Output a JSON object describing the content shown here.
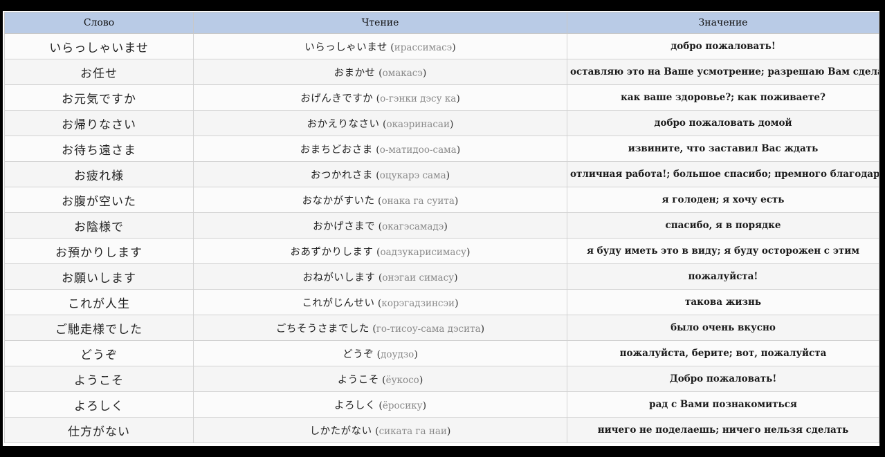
{
  "table": {
    "headers": [
      "Слово",
      "Чтение",
      "Значение"
    ],
    "rows": [
      {
        "word": "いらっしゃいませ",
        "kana": "いらっしゃいませ",
        "rom": "ирассимасэ",
        "meaning": "добро пожаловать!"
      },
      {
        "word": "お任せ",
        "kana": "おまかせ",
        "rom": "омакасэ",
        "meaning": "оставляю это на Ваше усмотрение; разрешаю Вам сделать это"
      },
      {
        "word": "お元気ですか",
        "kana": "おげんきですか",
        "rom": "о-гэнки дэсу ка",
        "meaning": "как ваше здоровье?; как поживаете?"
      },
      {
        "word": "お帰りなさい",
        "kana": "おかえりなさい",
        "rom": "окаэринасаи",
        "meaning": "добро пожаловать домой"
      },
      {
        "word": "お待ち遠さま",
        "kana": "おまちどおさま",
        "rom": "о-матидоо-сама",
        "meaning": "извините, что заставил Вас ждать"
      },
      {
        "word": "お疲れ様",
        "kana": "おつかれさま",
        "rom": "оцукарэ сама",
        "meaning": "отличная работа!; большое спасибо; премного благодарен"
      },
      {
        "word": "お腹が空いた",
        "kana": "おなかがすいた",
        "rom": "онака га суита",
        "meaning": "я голоден; я хочу есть"
      },
      {
        "word": "お陰様で",
        "kana": "おかげさまで",
        "rom": "окагэсамадэ",
        "meaning": "спасибо, я в порядке"
      },
      {
        "word": "お預かりします",
        "kana": "おあずかりします",
        "rom": "оадзукарисимасу",
        "meaning": "я буду иметь это в виду; я буду осторожен с этим"
      },
      {
        "word": "お願いします",
        "kana": "おねがいします",
        "rom": "онэгаи симасу",
        "meaning": "пожалуйста!"
      },
      {
        "word": "これが人生",
        "kana": "これがじんせい",
        "rom": "корэгадзинсэи",
        "meaning": "такова жизнь"
      },
      {
        "word": "ご馳走様でした",
        "kana": "ごちそうさまでした",
        "rom": "го-тисоу-сама дэсита",
        "meaning": "было очень вкусно"
      },
      {
        "word": "どうぞ",
        "kana": "どうぞ",
        "rom": "доудзо",
        "meaning": "пожалуйста, берите; вот, пожалуйста"
      },
      {
        "word": "ようこそ",
        "kana": "ようこそ",
        "rom": "ёукосо",
        "meaning": "Добро пожаловать!"
      },
      {
        "word": "よろしく",
        "kana": "よろしく",
        "rom": "ёросику",
        "meaning": "рад с Вами познакомиться"
      },
      {
        "word": "仕方がない",
        "kana": "しかたがない",
        "rom": "сиката га наи",
        "meaning": "ничего не поделаешь; ничего нельзя сделать"
      }
    ]
  },
  "colors": {
    "header_bg": "#b9cbe6",
    "romaji_text": "#8a8a8a",
    "frame": "#000000"
  }
}
